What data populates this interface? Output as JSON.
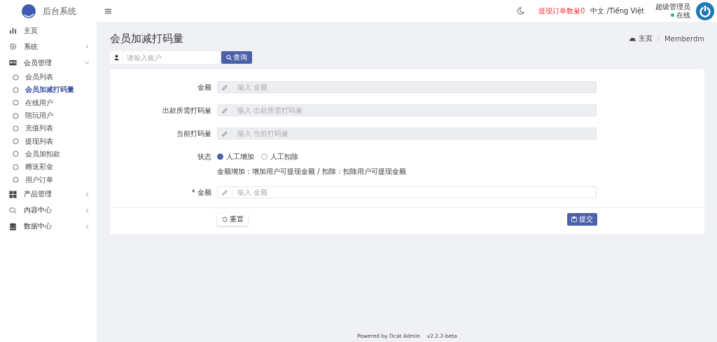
{
  "brand": {
    "name": "后台系统"
  },
  "menu": [
    {
      "label": "主页"
    },
    {
      "label": "系统",
      "expanded": false,
      "has_arrow": true
    },
    {
      "label": "会员管理",
      "expanded": true,
      "has_arrow": true,
      "children": [
        {
          "label": "会员列表",
          "selected": false
        },
        {
          "label": "会员加减打码量",
          "selected": true
        },
        {
          "label": "在线用户",
          "selected": false
        },
        {
          "label": "陪玩用户",
          "selected": false
        },
        {
          "label": "充值列表",
          "selected": false
        },
        {
          "label": "提现列表",
          "selected": false
        },
        {
          "label": "会员加扣款",
          "selected": false
        },
        {
          "label": "赠送彩金",
          "selected": false
        },
        {
          "label": "用户订单",
          "selected": false
        }
      ]
    },
    {
      "label": "产品管理",
      "expanded": false,
      "has_arrow": true
    },
    {
      "label": "内容中心",
      "expanded": false,
      "has_arrow": true
    },
    {
      "label": "数据中心",
      "expanded": false,
      "has_arrow": true
    }
  ],
  "topbar": {
    "alert": "提现订单数量0",
    "language": "中文 /Tiếng Việt",
    "user": "超级管理员",
    "status": "在线"
  },
  "page": {
    "title": "会员加减打码量",
    "breadcrumb": [
      "主页",
      "Memberdm"
    ]
  },
  "search": {
    "placeholder": "请输入账户",
    "button": "查询"
  },
  "form": {
    "fields": [
      {
        "label": "金额",
        "placeholder": "输入 金额",
        "disabled": true
      },
      {
        "label": "出款所需打码量",
        "placeholder": "输入 出款所需打码量",
        "disabled": true
      },
      {
        "label": "当前打码量",
        "placeholder": "输入 当前打码量",
        "disabled": true
      }
    ],
    "status": {
      "label": "状态",
      "options": [
        {
          "label": "人工增加",
          "selected": true
        },
        {
          "label": "人工扣除",
          "selected": false
        }
      ],
      "help": "金额增加：增加用户可提现金额 / 扣除：扣除用户可提现金额"
    },
    "amount": {
      "label": "* 金额",
      "placeholder": "输入 金额",
      "disabled": false
    },
    "reset": "重置",
    "submit": "提交"
  },
  "footer": {
    "powered": "Powered by Dcat Admin",
    "version": "v2.2.2-beta"
  }
}
